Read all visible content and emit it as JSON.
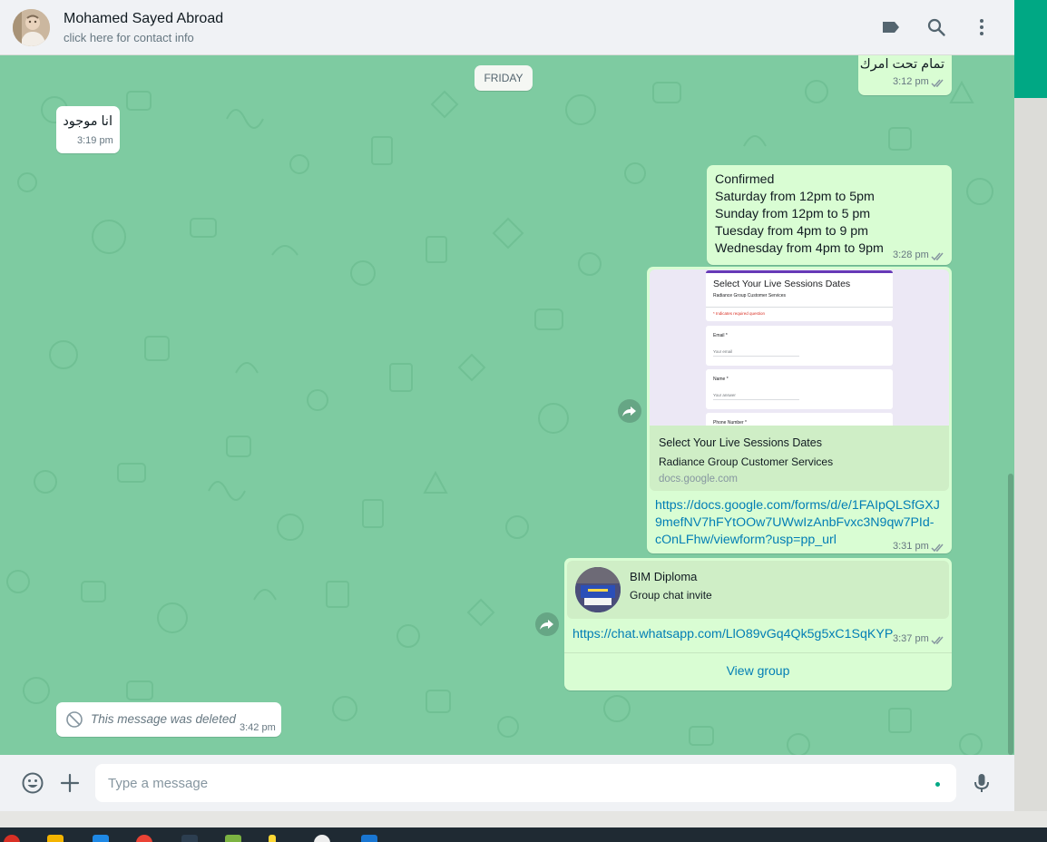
{
  "contact": {
    "name": "Mohamed Sayed Abroad",
    "subtitle": "click here for contact info"
  },
  "date_divider": "FRIDAY",
  "messages": [
    {
      "direction": "out",
      "text": "تمام تحت امرك",
      "time": "3:12 pm",
      "status": "read"
    },
    {
      "direction": "in",
      "text": "انا موجود",
      "time": "3:19 pm"
    },
    {
      "direction": "out",
      "lines": [
        "Confirmed",
        "Saturday from 12pm to 5pm",
        "Sunday from 12pm to 5 pm",
        "Tuesday from 4pm to 9 pm",
        "Wednesday from 4pm to 9pm"
      ],
      "time": "3:28 pm",
      "status": "read"
    },
    {
      "direction": "out",
      "preview": {
        "form_title": "Select Your Live Sessions Dates",
        "form_org": "Radiance Group Customer Services",
        "form_required": "* Indicates required question",
        "fields": [
          {
            "label": "Email *",
            "placeholder": "Your email"
          },
          {
            "label": "Name *",
            "placeholder": "Your answer"
          },
          {
            "label": "Phone Number *"
          }
        ],
        "title": "Select Your Live Sessions Dates",
        "description": "Radiance Group Customer Services",
        "domain": "docs.google.com"
      },
      "link_lines": [
        "https://docs.google.com/forms/d/e/1FAIpQLSfGXJ",
        "9mefNV7hFYtOOw7UWwIzAnbFvxc3N9qw7PId-",
        "cOnLFhw/viewform?usp=pp_url"
      ],
      "time": "3:31 pm",
      "status": "read"
    },
    {
      "direction": "out",
      "invite": {
        "group_name": "BIM Diploma",
        "caption": "Group chat invite",
        "link": "https://chat.whatsapp.com/LlO89vGq4Qk5g5xC1SqKYP",
        "button": "View group"
      },
      "time": "3:37 pm",
      "status": "read"
    },
    {
      "direction": "in",
      "deleted": true,
      "text": "This message was deleted",
      "time": "3:42 pm"
    }
  ],
  "composer": {
    "placeholder": "Type a message"
  },
  "icons": {
    "header": [
      "label-icon",
      "search-icon",
      "menu-dots-icon"
    ],
    "footer": [
      "emoji-icon",
      "attach-plus-icon",
      "microphone-icon"
    ],
    "message": [
      "forward-icon",
      "double-check-icon",
      "blocked-icon"
    ]
  },
  "colors": {
    "chat_bg": "#7ecba1",
    "outgoing_bubble": "#d9fdd3",
    "incoming_bubble": "#ffffff",
    "header_bg": "#f0f2f5",
    "accent": "#00a884",
    "link": "#027eb5",
    "read_ticks": "#8696a0"
  }
}
